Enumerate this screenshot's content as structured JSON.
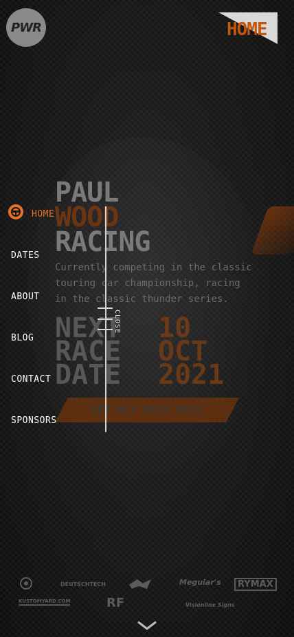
{
  "logo": {
    "text": "PWR"
  },
  "header": {
    "home_badge": "HOME"
  },
  "hero": {
    "title_lines": [
      "PAUL",
      "WOOD",
      "RACING"
    ],
    "description": "Currently competing in the classic touring car championship, racing in the classic thunder series.",
    "next_lines": [
      "NEXT",
      "RACE",
      "DATE"
    ],
    "date_lines": [
      "10",
      "OCT",
      "2021"
    ],
    "cta": "SEE ALL RACE DAYS"
  },
  "menu": {
    "items": [
      "HOME",
      "DATES",
      "ABOUT",
      "BLOG",
      "CONTACT",
      "SPONSORS"
    ],
    "active": "HOME",
    "close_label": "CLOSE"
  },
  "sponsors": [
    "DEUTSCHTECH",
    "Meguiar's",
    "RYMAX",
    "KUSTOMYARD.COM",
    "RF",
    "Visionline Signs"
  ],
  "colors": {
    "accent": "#e8712a",
    "background": "#141414",
    "cta": "#5b2f0f"
  },
  "icons": {
    "home": "steering-wheel-icon",
    "close": "menu-close-icon",
    "scroll": "chevron-down-icon"
  }
}
